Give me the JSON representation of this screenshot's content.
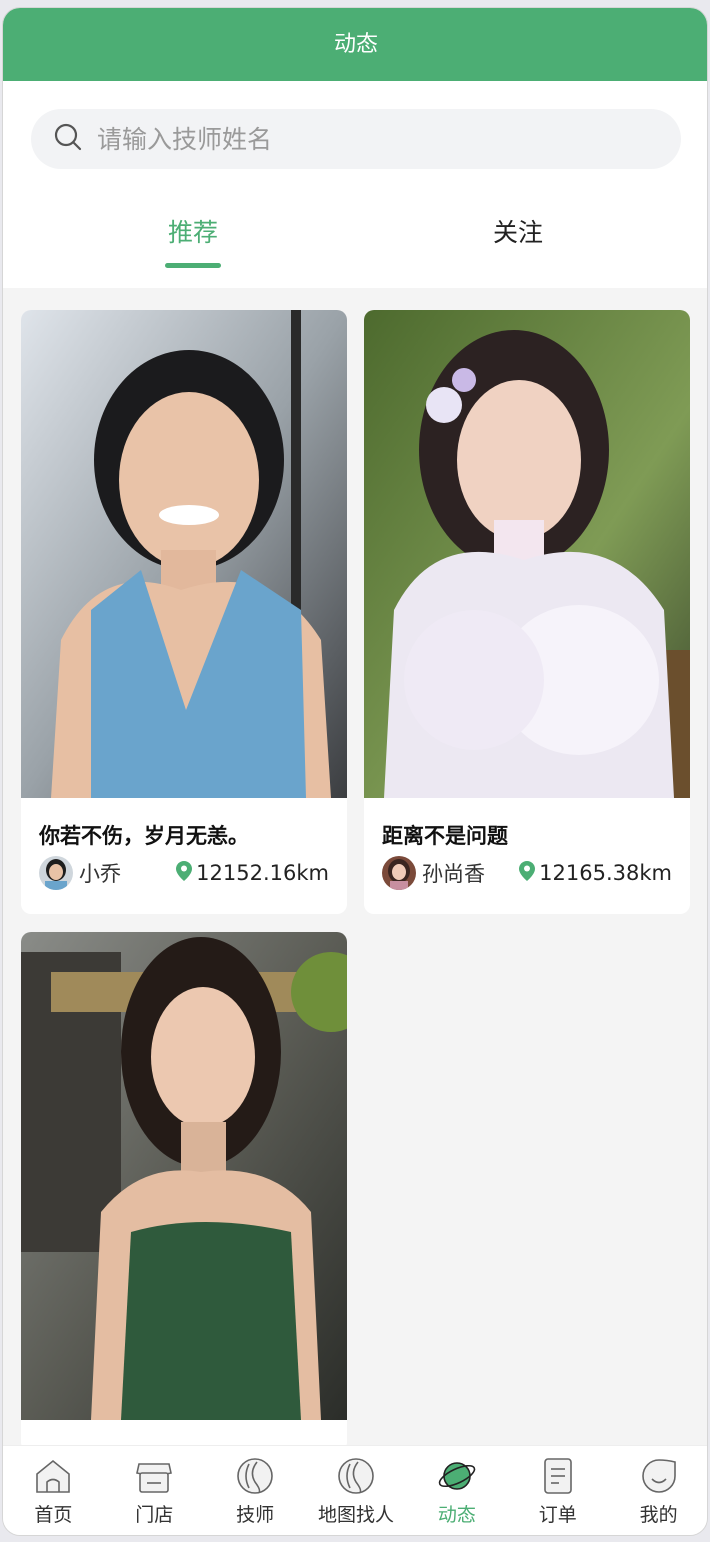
{
  "header": {
    "title": "动态"
  },
  "search": {
    "placeholder": "请输入技师姓名"
  },
  "tabs": [
    {
      "label": "推荐",
      "active": true
    },
    {
      "label": "关注",
      "active": false
    }
  ],
  "posts": [
    {
      "title": "你若不伤，岁月无恙。",
      "author": "小乔",
      "distance": "12152.16km"
    },
    {
      "title": "距离不是问题",
      "author": "孙尚香",
      "distance": "12165.38km"
    },
    {
      "title": "",
      "author": "",
      "distance": ""
    }
  ],
  "tabbar": {
    "items": [
      {
        "label": "首页",
        "icon": "home-icon"
      },
      {
        "label": "门店",
        "icon": "store-icon"
      },
      {
        "label": "技师",
        "icon": "technician-icon"
      },
      {
        "label": "地图找人",
        "icon": "map-person-icon"
      },
      {
        "label": "动态",
        "icon": "planet-icon",
        "active": true
      },
      {
        "label": "订单",
        "icon": "order-icon"
      },
      {
        "label": "我的",
        "icon": "profile-icon"
      }
    ]
  },
  "colors": {
    "brand": "#4cae74",
    "background": "#f4f4f4"
  }
}
